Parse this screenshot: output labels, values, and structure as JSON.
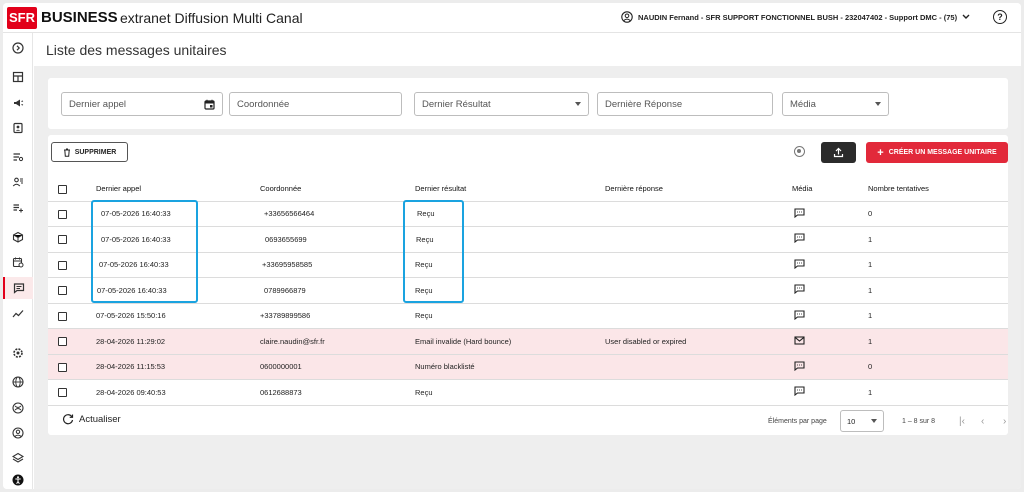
{
  "header": {
    "logo": "SFR",
    "brand": "BUSINESS",
    "app_title": "extranet Diffusion Multi Canal",
    "user": "NAUDIN Fernand - SFR SUPPORT FONCTIONNEL BUSH - 232047402 - Support DMC - (75)",
    "help": "?"
  },
  "page": {
    "title": "Liste des messages unitaires"
  },
  "filters": {
    "last_call": "Dernier appel",
    "contact": "Coordonnée",
    "last_result": "Dernier Résultat",
    "last_response": "Dernière Réponse",
    "media": "Média"
  },
  "actions": {
    "delete": "SUPPRIMER",
    "create": "CRÉER UN MESSAGE UNITAIRE"
  },
  "table": {
    "columns": [
      "Dernier appel",
      "Coordonnée",
      "Dernier résultat",
      "Dernière réponse",
      "Média",
      "Nombre tentatives"
    ],
    "rows": [
      {
        "date": "07-05-2026 16:40:33",
        "contact": "+33656566464",
        "result": "Reçu",
        "response": "",
        "media": "sms",
        "attempts": "0",
        "error": false
      },
      {
        "date": "07-05-2026 16:40:33",
        "contact": "0693655699",
        "result": "Reçu",
        "response": "",
        "media": "sms",
        "attempts": "1",
        "error": false
      },
      {
        "date": "07-05-2026 16:40:33",
        "contact": "+33695958585",
        "result": "Reçu",
        "response": "",
        "media": "sms",
        "attempts": "1",
        "error": false
      },
      {
        "date": "07-05-2026 16:40:33",
        "contact": "0789966879",
        "result": "Reçu",
        "response": "",
        "media": "sms",
        "attempts": "1",
        "error": false
      },
      {
        "date": "07-05-2026 15:50:16",
        "contact": "+33789899586",
        "result": "Reçu",
        "response": "",
        "media": "sms",
        "attempts": "1",
        "error": false
      },
      {
        "date": "28-04-2026 11:29:02",
        "contact": "claire.naudin@sfr.fr",
        "result": "Email invalide (Hard bounce)",
        "response": "User disabled or expired",
        "media": "email",
        "attempts": "1",
        "error": true
      },
      {
        "date": "28-04-2026 11:15:53",
        "contact": "0600000001",
        "result": "Numéro blacklisté",
        "response": "",
        "media": "sms",
        "attempts": "0",
        "error": true
      },
      {
        "date": "28-04-2026 09:40:53",
        "contact": "0612688873",
        "result": "Reçu",
        "response": "",
        "media": "sms",
        "attempts": "1",
        "error": false
      }
    ]
  },
  "footer": {
    "refresh": "Actualiser",
    "per_page_label": "Éléments par page",
    "per_page_value": "10",
    "range": "1 – 8 sur 8"
  },
  "colors": {
    "brand_red": "#e2001a",
    "create_button": "#e2293a",
    "highlight": "#1aa3e0",
    "error_row": "#fbe6e8"
  }
}
